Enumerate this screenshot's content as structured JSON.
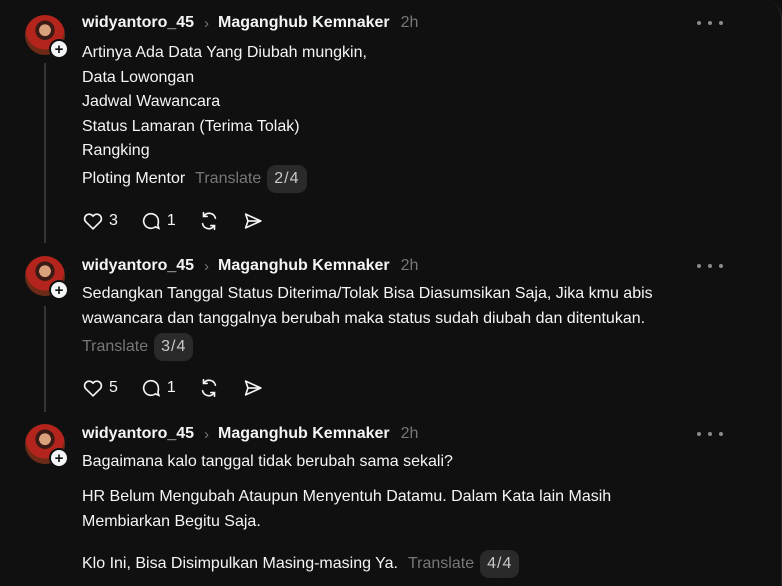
{
  "posts": [
    {
      "username": "widyantoro_45",
      "community": "Maganghub Kemnaker",
      "time": "2h",
      "lines": "Artinya Ada Data Yang Diubah mungkin,\nData Lowongan\nJadwal Wawancara\nStatus Lamaran (Terima Tolak)\nRangking",
      "last_line": "Ploting Mentor",
      "translate": "Translate",
      "pager": "2/4",
      "likes": "3",
      "replies": "1"
    },
    {
      "username": "widyantoro_45",
      "community": "Maganghub Kemnaker",
      "time": "2h",
      "lines": "Sedangkan Tanggal Status Diterima/Tolak Bisa Diasumsikan Saja, Jika kmu abis\nwawancara dan tanggalnya berubah maka status sudah diubah dan ditentukan.",
      "translate": "Translate",
      "pager": "3/4",
      "likes": "5",
      "replies": "1"
    },
    {
      "username": "widyantoro_45",
      "community": "Maganghub Kemnaker",
      "time": "2h",
      "para1": "Bagaimana kalo tanggal tidak berubah sama sekali?",
      "para2": "HR Belum Mengubah Ataupun Menyentuh Datamu. Dalam Kata lain Masih\nMembiarkan Begitu Saja.",
      "last_line": "Klo Ini, Bisa Disimpulkan Masing-masing Ya.",
      "translate": "Translate",
      "pager": "4/4"
    }
  ],
  "icons": {
    "separator": "chevron-right-icon",
    "more": "more-icon",
    "like": "heart-icon",
    "reply": "comment-icon",
    "repost": "repost-icon",
    "share": "send-icon"
  }
}
